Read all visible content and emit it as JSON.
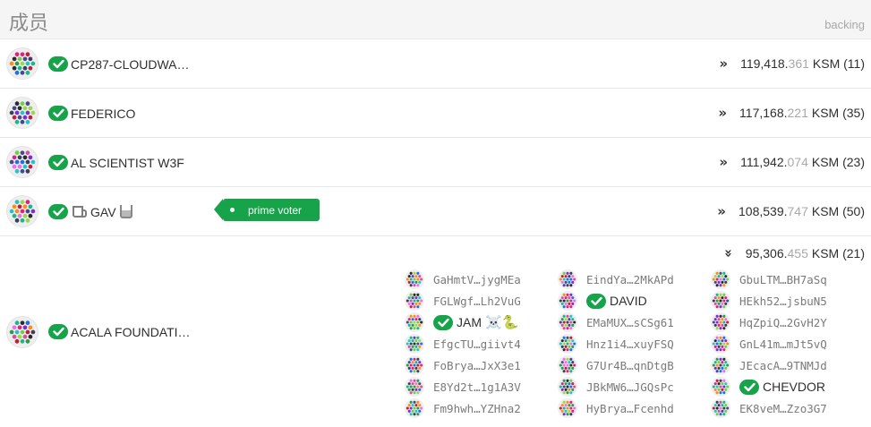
{
  "header": {
    "title": "成员",
    "column_label": "backing"
  },
  "validators": [
    {
      "name": "CP287-CLOUDWA…",
      "backing_int": "119,418.",
      "backing_dec": "361",
      "unit": "KSM",
      "count": "(11)",
      "expand": "»"
    },
    {
      "name": "FEDERICO",
      "backing_int": "117,168.",
      "backing_dec": "221",
      "unit": "KSM",
      "count": "(35)",
      "expand": "»"
    },
    {
      "name": "AL SCIENTIST W3F",
      "backing_int": "111,942.",
      "backing_dec": "074",
      "unit": "KSM",
      "count": "(23)",
      "expand": "»"
    },
    {
      "name": "GAV",
      "backing_int": "108,539.",
      "backing_dec": "747",
      "unit": "KSM",
      "count": "(50)",
      "expand": "»",
      "tag": "prime voter"
    },
    {
      "name": "ACALA FOUNDATI…",
      "backing_int": "95,306.",
      "backing_dec": "455",
      "unit": "KSM",
      "count": "(21)",
      "expand": "»"
    }
  ],
  "nominators": {
    "col1": [
      "GaHmtV…jygMEa",
      "FGLWgf…Lh2VuG",
      "JAM",
      "EfgcTU…giivt4",
      "FoBrya…JxX3e1",
      "E8Yd2t…1g1A3V",
      "Fm9hwh…YZHna2"
    ],
    "col2": [
      "EindYa…2MkAPd",
      "DAVID",
      "EMaMUX…sCSg61",
      "Hnz1i4…xuyFSQ",
      "G7Ur4B…qnDtgB",
      "JBkMW6…JGQsPc",
      "HyBrya…Fcenhd"
    ],
    "col3": [
      "GbuLTM…BH7aSq",
      "HEkh52…jsbuN5",
      "HqZpiQ…2GvH2Y",
      "GnL41m…mJt5vQ",
      "JEcacA…9TNMJd",
      "CHEVDOR",
      "EK8veM…Zzo3G7"
    ],
    "jam_emoji": "☠️🐍"
  },
  "colors": {
    "accent_green": "#16a34a",
    "muted": "#a8a8a8"
  }
}
